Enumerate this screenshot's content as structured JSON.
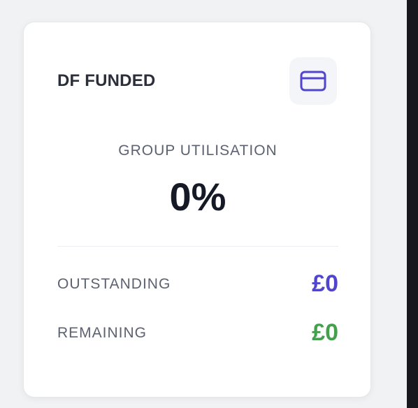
{
  "card": {
    "title": "DF FUNDED",
    "icon": "credit-card-icon",
    "utilisation": {
      "label": "GROUP UTILISATION",
      "value": "0%"
    },
    "stats": [
      {
        "label": "OUTSTANDING",
        "value": "£0"
      },
      {
        "label": "REMAINING",
        "value": "£0"
      }
    ]
  },
  "colors": {
    "outstanding": "#5145cd",
    "remaining": "#43a14d",
    "icon": "#5145cd"
  }
}
